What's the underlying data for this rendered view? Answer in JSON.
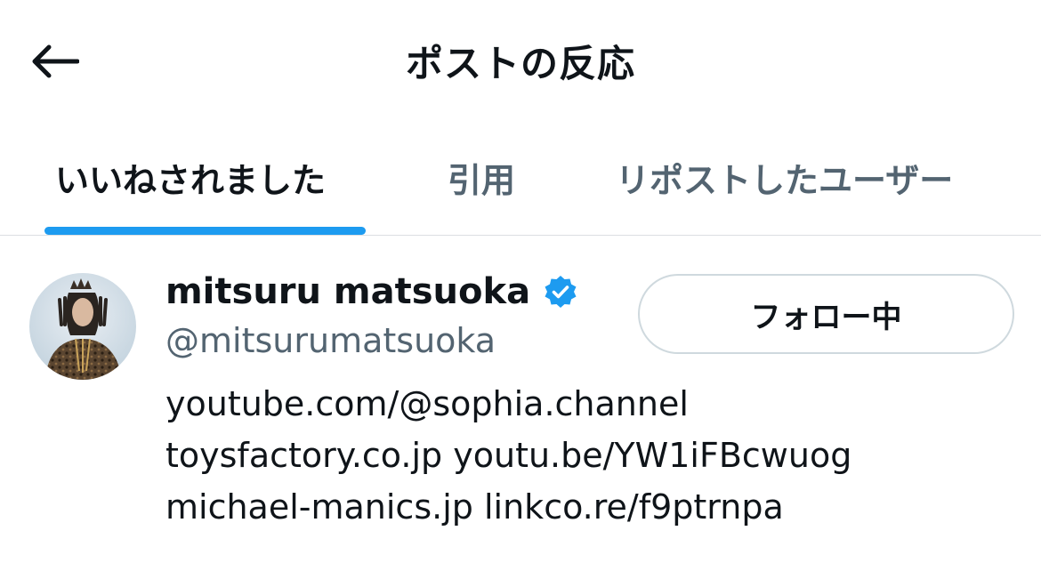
{
  "header": {
    "title": "ポストの反応",
    "back_icon": "arrow-left-icon"
  },
  "tabs": [
    {
      "label": "いいねされました",
      "active": true
    },
    {
      "label": "引用",
      "active": false
    },
    {
      "label": "リポストしたユーザー",
      "active": false
    }
  ],
  "accent_color": "#1d9bf0",
  "user": {
    "display_name": "mitsuru matsuoka",
    "verified": true,
    "verified_icon": "verified-badge-icon",
    "handle": "@mitsurumatsuoka",
    "follow_button_label": "フォロー中",
    "bio": {
      "line1": {
        "link1": "youtube.com/@sophia.channel"
      },
      "line2": {
        "link1": "toysfactory.co.jp",
        "link2": "youtu.be/YW1iFBcwuog"
      },
      "line3": {
        "link1": "michael-manics.jp",
        "link2": "linkco.re/f9ptrnpa"
      }
    }
  }
}
